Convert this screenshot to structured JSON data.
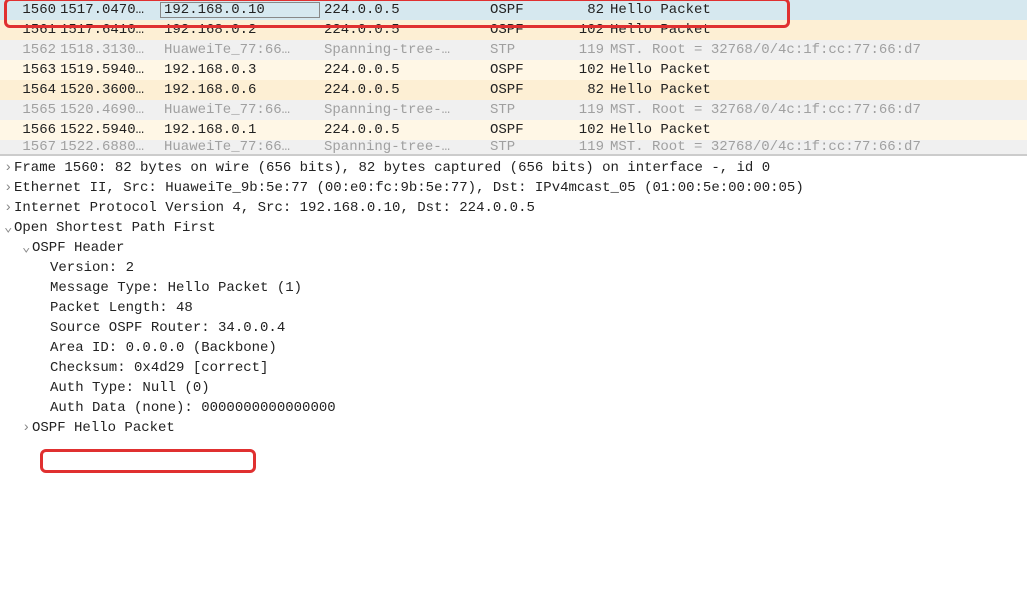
{
  "packet_list": {
    "rows": [
      {
        "no": "1560",
        "time": "1517.0470…",
        "src": "192.168.0.10",
        "dst": "224.0.0.5",
        "proto": "OSPF",
        "len": "82",
        "info": "Hello Packet",
        "style": "selected",
        "srcOutlined": true
      },
      {
        "no": "1561",
        "time": "1517.6410…",
        "src": "192.168.0.2",
        "dst": "224.0.0.5",
        "proto": "OSPF",
        "len": "102",
        "info": "Hello Packet",
        "style": "ospf"
      },
      {
        "no": "1562",
        "time": "1518.3130…",
        "src": "HuaweiTe_77:66…",
        "dst": "Spanning-tree-…",
        "proto": "STP",
        "len": "119",
        "info": "MST. Root = 32768/0/4c:1f:cc:77:66:d7",
        "style": "stp"
      },
      {
        "no": "1563",
        "time": "1519.5940…",
        "src": "192.168.0.3",
        "dst": "224.0.0.5",
        "proto": "OSPF",
        "len": "102",
        "info": "Hello Packet",
        "style": "ospf-alt"
      },
      {
        "no": "1564",
        "time": "1520.3600…",
        "src": "192.168.0.6",
        "dst": "224.0.0.5",
        "proto": "OSPF",
        "len": "82",
        "info": "Hello Packet",
        "style": "ospf"
      },
      {
        "no": "1565",
        "time": "1520.4690…",
        "src": "HuaweiTe_77:66…",
        "dst": "Spanning-tree-…",
        "proto": "STP",
        "len": "119",
        "info": "MST. Root = 32768/0/4c:1f:cc:77:66:d7",
        "style": "stp"
      },
      {
        "no": "1566",
        "time": "1522.5940…",
        "src": "192.168.0.1",
        "dst": "224.0.0.5",
        "proto": "OSPF",
        "len": "102",
        "info": "Hello Packet",
        "style": "ospf-alt"
      },
      {
        "no": "1567",
        "time": "1522.6880…",
        "src": "HuaweiTe_77:66…",
        "dst": "Spanning-tree-…",
        "proto": "STP",
        "len": "119",
        "info": "MST. Root = 32768/0/4c:1f:cc:77:66:d7",
        "style": "stp",
        "clipped": true
      }
    ]
  },
  "details": {
    "frame": "Frame 1560: 82 bytes on wire (656 bits), 82 bytes captured (656 bits) on interface -, id 0",
    "eth": "Ethernet II, Src: HuaweiTe_9b:5e:77 (00:e0:fc:9b:5e:77), Dst: IPv4mcast_05 (01:00:5e:00:00:05)",
    "ip": "Internet Protocol Version 4, Src: 192.168.0.10, Dst: 224.0.0.5",
    "ospf": "Open Shortest Path First",
    "ospf_header": "OSPF Header",
    "version": "Version: 2",
    "msgtype": "Message Type: Hello Packet (1)",
    "pktlen": "Packet Length: 48",
    "src_router": "Source OSPF Router: 34.0.0.4",
    "area": "Area ID: 0.0.0.0 (Backbone)",
    "checksum": "Checksum: 0x4d29 [correct]",
    "authtype": "Auth Type: Null (0)",
    "authdata": "Auth Data (none): 0000000000000000",
    "hello": "OSPF Hello Packet"
  }
}
